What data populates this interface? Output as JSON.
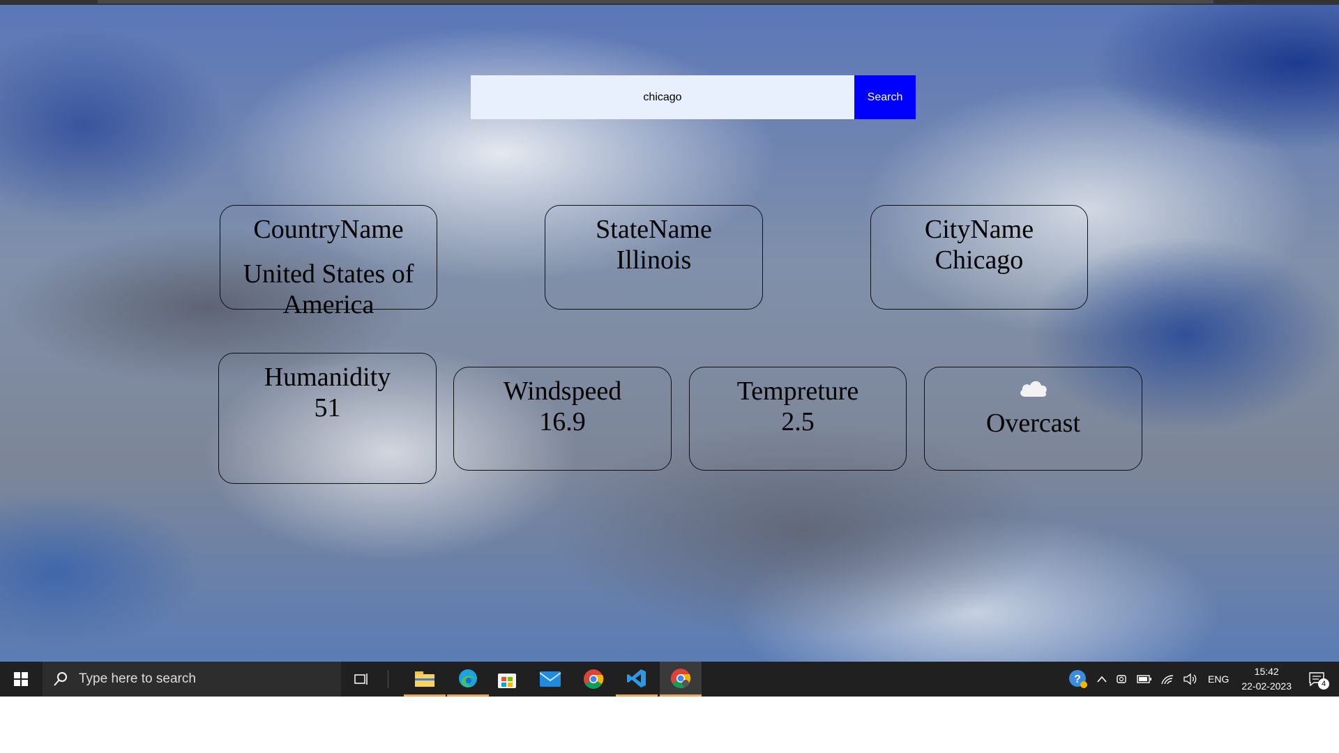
{
  "search": {
    "value": "chicago",
    "button_label": "Search"
  },
  "cards": {
    "country": {
      "label": "CountryName",
      "value": "United States of America"
    },
    "state": {
      "label": "StateName",
      "value": "Illinois"
    },
    "city": {
      "label": "CityName",
      "value": "Chicago"
    },
    "humidity": {
      "label": "Humanidity",
      "value": "51"
    },
    "wind": {
      "label": "Windspeed",
      "value": "16.9"
    },
    "temperature": {
      "label": "Tempreture",
      "value": "2.5"
    },
    "condition": {
      "icon": "cloud-icon",
      "value": "Overcast"
    }
  },
  "taskbar": {
    "search_placeholder": "Type here to search",
    "apps": [
      "file-explorer-icon",
      "edge-icon",
      "store-icon",
      "mail-icon",
      "chrome-icon",
      "vscode-icon",
      "chrome-profile-icon"
    ],
    "language": "ENG",
    "time": "15:42",
    "date": "22-02-2023",
    "notification_count": "4"
  },
  "colors": {
    "search_field": "#e8f0fe",
    "search_button": "#0000ff",
    "taskbar": "#202020",
    "active_app_underline": "#f0a35e"
  }
}
